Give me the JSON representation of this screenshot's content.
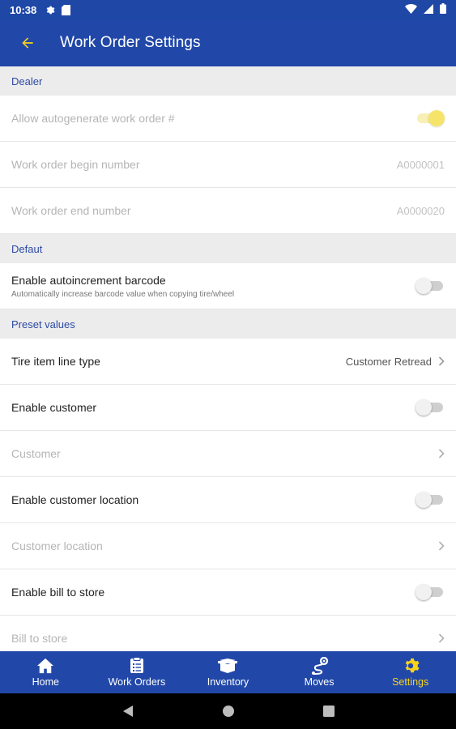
{
  "status_bar": {
    "time": "10:38"
  },
  "app_bar": {
    "title": "Work Order Settings"
  },
  "sections": {
    "dealer": {
      "header": "Dealer",
      "allow_autogenerate_label": "Allow autogenerate work order #",
      "begin_number_label": "Work order begin number",
      "begin_number_value": "A0000001",
      "end_number_label": "Work order end number",
      "end_number_value": "A0000020"
    },
    "default": {
      "header": "Defaut",
      "autoincrement_label": "Enable autoincrement barcode",
      "autoincrement_sub": "Automatically increase barcode value when copying tire/wheel"
    },
    "preset": {
      "header": "Preset values",
      "tire_item_label": "Tire item line type",
      "tire_item_value": "Customer Retread",
      "enable_customer_label": "Enable customer",
      "customer_label": "Customer",
      "enable_customer_location_label": "Enable customer location",
      "customer_location_label": "Customer location",
      "enable_bill_to_store_label": "Enable bill to store",
      "bill_to_store_label": "Bill to store"
    }
  },
  "toggles": {
    "allow_autogenerate": true,
    "autoincrement_barcode": false,
    "enable_customer": false,
    "enable_customer_location": false,
    "enable_bill_to_store": false
  },
  "bottom_nav": {
    "items": [
      {
        "label": "Home",
        "icon": "home-icon"
      },
      {
        "label": "Work Orders",
        "icon": "clipboard-icon"
      },
      {
        "label": "Inventory",
        "icon": "inventory-icon"
      },
      {
        "label": "Moves",
        "icon": "route-icon"
      },
      {
        "label": "Settings",
        "icon": "gear-icon"
      }
    ],
    "active": "Settings"
  },
  "colors": {
    "primary": "#2148a8",
    "accent": "#f6d21f",
    "section_bg": "#ececec",
    "section_text": "#2c4aa6"
  }
}
